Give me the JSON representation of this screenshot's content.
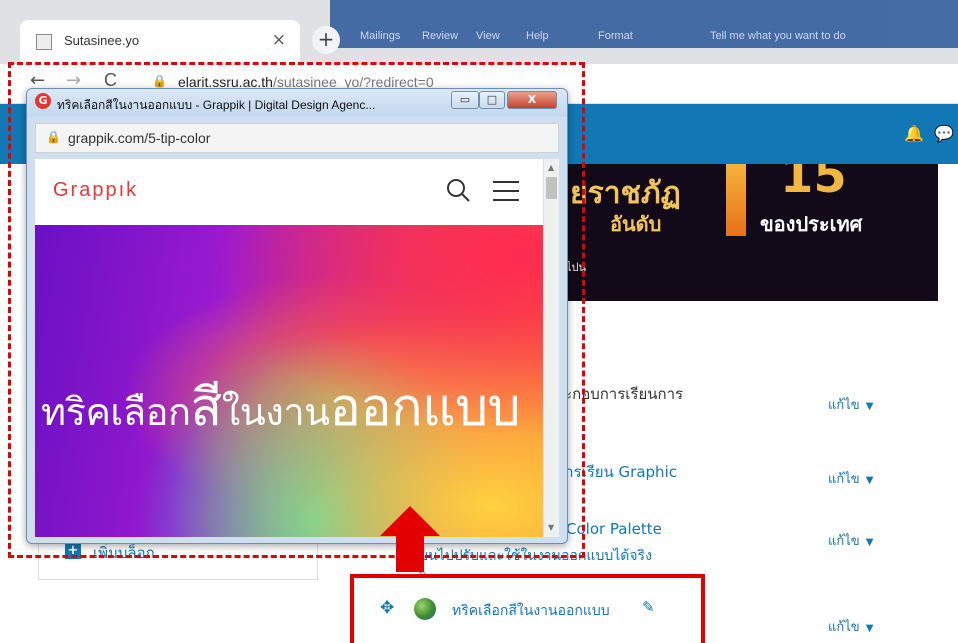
{
  "browser": {
    "tab_title": "Sutasinee.yo",
    "tab_close": "×",
    "new_tab": "+",
    "back": "←",
    "forward": "→",
    "reload": "C",
    "url_host": "elarit.ssru.ac.th",
    "url_path": "/sutasinee_yo/?redirect=0"
  },
  "ribbon_tabs": [
    "Mailings",
    "Review",
    "View",
    "Help",
    "Format",
    "Tell me what you want to do"
  ],
  "header": {
    "bell_icon": "bell-icon",
    "chat_icon": "chat-icon"
  },
  "banner": {
    "line1": "ยราชภัฏ",
    "line2": "อันดับ",
    "number": "15",
    "line3": "ของประเทศ",
    "line4": "เทศไปน"
  },
  "course_items": [
    {
      "text": "ระกอบการเรียนการ",
      "edit": "แก้ไข"
    },
    {
      "text": "การเรียน Graphic",
      "edit": "แก้ไข"
    },
    {
      "text": "Color Palette",
      "text2": "ยนไปปรับและใช้ในงานออกแบบได้จริง",
      "edit": "แก้ไข"
    },
    {
      "text": "ทริคเลือกสีในงานออกแบบ",
      "edit": "แก้ไข"
    }
  ],
  "left_block": {
    "label": "เพิ่มบล็อก"
  },
  "popup": {
    "title": "ทริคเลือกสีในงานออกแบบ - Grappik | Digital Design Agenc...",
    "url": "grappik.com/5-tip-color",
    "brand": "Grappık",
    "hero_text_a": "ทริคเลือก",
    "hero_text_b": "สี",
    "hero_text_c": "ในงาน",
    "hero_text_d": "ออกแบบ",
    "btn_min": "▭",
    "btn_max": "□",
    "btn_close": "X"
  },
  "colors": {
    "accent": "#1177b5",
    "highlight": "#e30000",
    "brand_red": "#e53935"
  }
}
